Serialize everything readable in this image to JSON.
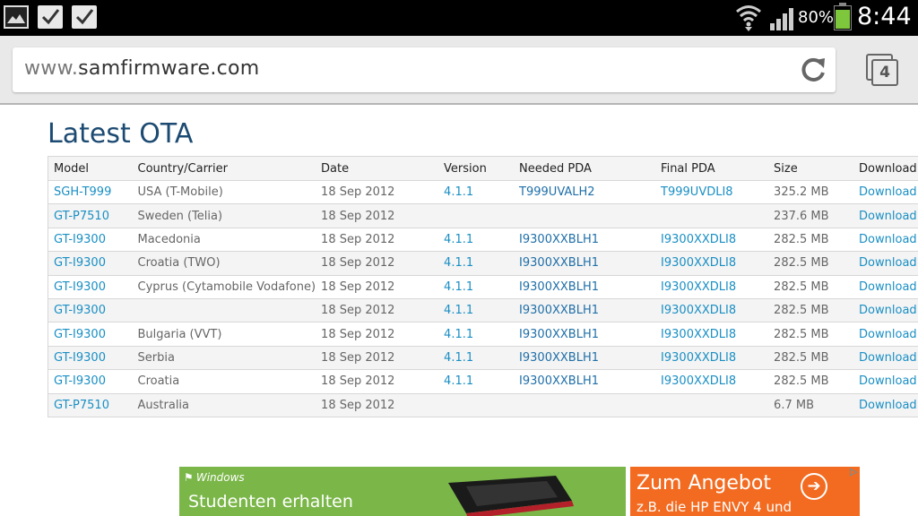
{
  "status_bar": {
    "battery_percent": "80%",
    "battery_level": 0.8,
    "time": "8:44",
    "icons": [
      "gallery-icon",
      "checkbox-icon",
      "checkbox-icon",
      "wifi-icon",
      "signal-icon",
      "battery-icon"
    ]
  },
  "browser": {
    "url_prefix": "www.",
    "url_domain": "samfirmware.com",
    "tab_count": "4"
  },
  "page": {
    "title": "Latest OTA",
    "columns": [
      "Model",
      "Country/Carrier",
      "Date",
      "Version",
      "Needed PDA",
      "Final PDA",
      "Size",
      "Download lin"
    ],
    "rows": [
      {
        "model": "SGH-T999",
        "country": "USA (T-Mobile)",
        "date": "18 Sep 2012",
        "version": "4.1.1",
        "needed": "T999UVALH2",
        "final": "T999UVDLI8",
        "size": "325.2 MB",
        "download": "Download"
      },
      {
        "model": "GT-P7510",
        "country": "Sweden (Telia)",
        "date": "18 Sep 2012",
        "version": "",
        "needed": "",
        "final": "",
        "size": "237.6 MB",
        "download": "Download"
      },
      {
        "model": "GT-I9300",
        "country": "Macedonia",
        "date": "18 Sep 2012",
        "version": "4.1.1",
        "needed": "I9300XXBLH1",
        "final": "I9300XXDLI8",
        "size": "282.5 MB",
        "download": "Download"
      },
      {
        "model": "GT-I9300",
        "country": "Croatia (TWO)",
        "date": "18 Sep 2012",
        "version": "4.1.1",
        "needed": "I9300XXBLH1",
        "final": "I9300XXDLI8",
        "size": "282.5 MB",
        "download": "Download"
      },
      {
        "model": "GT-I9300",
        "country": "Cyprus (Cytamobile Vodafone)",
        "date": "18 Sep 2012",
        "version": "4.1.1",
        "needed": "I9300XXBLH1",
        "final": "I9300XXDLI8",
        "size": "282.5 MB",
        "download": "Download"
      },
      {
        "model": "GT-I9300",
        "country": "",
        "date": "18 Sep 2012",
        "version": "4.1.1",
        "needed": "I9300XXBLH1",
        "final": "I9300XXDLI8",
        "size": "282.5 MB",
        "download": "Download"
      },
      {
        "model": "GT-I9300",
        "country": "Bulgaria (VVT)",
        "date": "18 Sep 2012",
        "version": "4.1.1",
        "needed": "I9300XXBLH1",
        "final": "I9300XXDLI8",
        "size": "282.5 MB",
        "download": "Download"
      },
      {
        "model": "GT-I9300",
        "country": "Serbia",
        "date": "18 Sep 2012",
        "version": "4.1.1",
        "needed": "I9300XXBLH1",
        "final": "I9300XXDLI8",
        "size": "282.5 MB",
        "download": "Download"
      },
      {
        "model": "GT-I9300",
        "country": "Croatia",
        "date": "18 Sep 2012",
        "version": "4.1.1",
        "needed": "I9300XXBLH1",
        "final": "I9300XXDLI8",
        "size": "282.5 MB",
        "download": "Download"
      },
      {
        "model": "GT-P7510",
        "country": "Australia",
        "date": "18 Sep 2012",
        "version": "",
        "needed": "",
        "final": "",
        "size": "6.7 MB",
        "download": "Download"
      }
    ]
  },
  "ad": {
    "brand": "Windows",
    "headline": "Studenten erhalten",
    "cta": "Zum Angebot",
    "subtext": "z.B. die HP ENVY 4 und",
    "colors": {
      "left": "#7ab648",
      "right": "#f26b21"
    }
  },
  "colors": {
    "title": "#1c4a72",
    "link": "#1a8fc4",
    "battery": "#7ec63b"
  }
}
